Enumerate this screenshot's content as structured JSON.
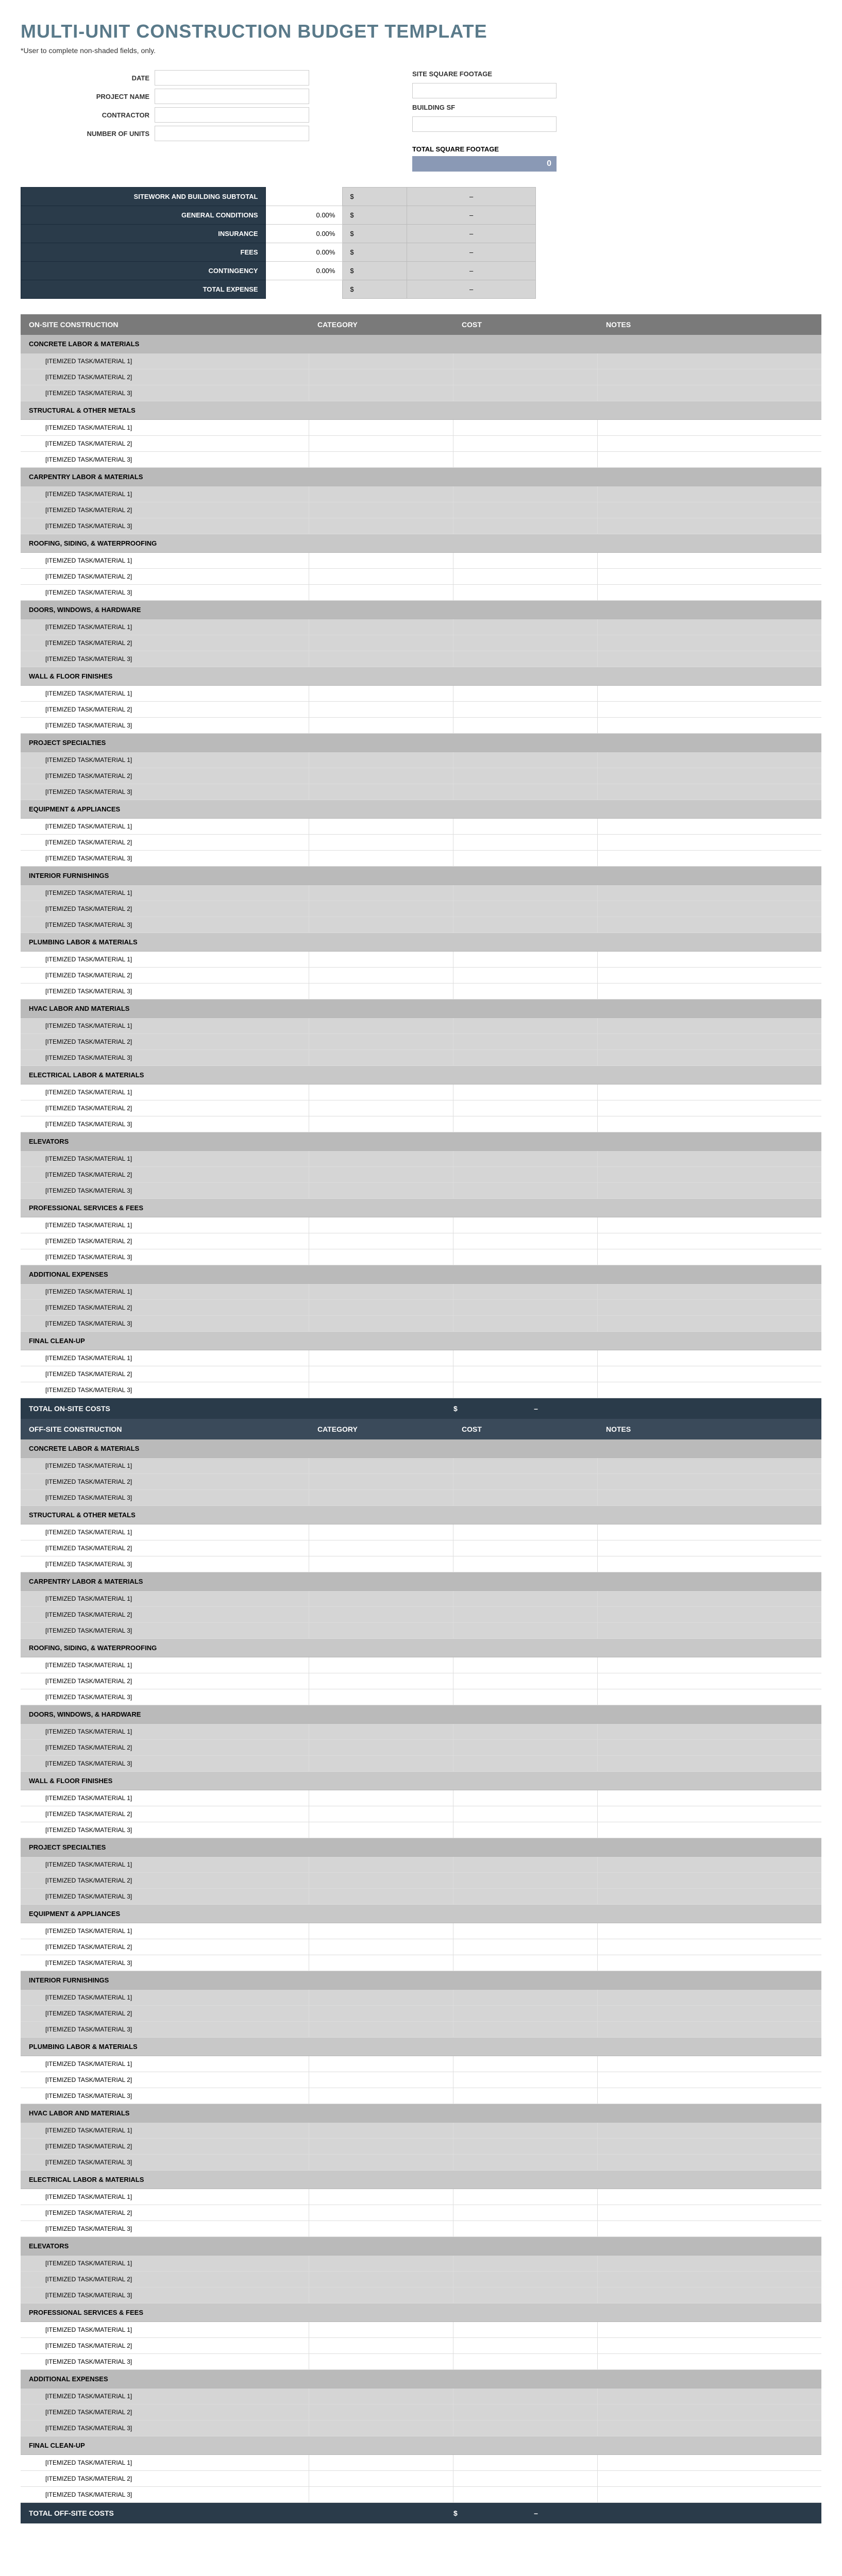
{
  "title": "MULTI-UNIT CONSTRUCTION BUDGET TEMPLATE",
  "subtitle": "*User to complete non-shaded fields, only.",
  "leftFields": [
    {
      "label": "DATE"
    },
    {
      "label": "PROJECT NAME"
    },
    {
      "label": "CONTRACTOR"
    },
    {
      "label": "NUMBER OF UNITS"
    }
  ],
  "rightFields": [
    {
      "label": "SITE SQUARE FOOTAGE"
    },
    {
      "label": "BUILDING SF"
    }
  ],
  "totalSfLabel": "TOTAL SQUARE FOOTAGE",
  "totalSfValue": "0",
  "summary": [
    {
      "label": "SITEWORK AND BUILDING SUBTOTAL",
      "pct": "",
      "dollar": "$",
      "val": "–"
    },
    {
      "label": "GENERAL CONDITIONS",
      "pct": "0.00%",
      "dollar": "$",
      "val": "–"
    },
    {
      "label": "INSURANCE",
      "pct": "0.00%",
      "dollar": "$",
      "val": "–"
    },
    {
      "label": "FEES",
      "pct": "0.00%",
      "dollar": "$",
      "val": "–"
    },
    {
      "label": "CONTINGENCY",
      "pct": "0.00%",
      "dollar": "$",
      "val": "–"
    },
    {
      "label": "TOTAL EXPENSE",
      "pct": "",
      "dollar": "$",
      "val": "–"
    }
  ],
  "headers": {
    "name_onsite": "ON-SITE CONSTRUCTION",
    "name_offsite": "OFF-SITE CONSTRUCTION",
    "category": "CATEGORY",
    "cost": "COST",
    "notes": "NOTES"
  },
  "categories": [
    "CONCRETE LABOR & MATERIALS",
    "STRUCTURAL & OTHER METALS",
    "CARPENTRY LABOR & MATERIALS",
    "ROOFING, SIDING, & WATERPROOFING",
    "DOORS, WINDOWS, & HARDWARE",
    "WALL & FLOOR FINISHES",
    "PROJECT SPECIALTIES",
    "EQUIPMENT & APPLIANCES",
    "INTERIOR FURNISHINGS",
    "PLUMBING LABOR & MATERIALS",
    "HVAC LABOR AND MATERIALS",
    "ELECTRICAL LABOR & MATERIALS",
    "ELEVATORS",
    "PROFESSIONAL SERVICES & FEES",
    "ADDITIONAL EXPENSES",
    "FINAL CLEAN-UP"
  ],
  "itemPlaceholder": "[ITEMIZED TASK/MATERIAL {n}]",
  "totals": {
    "onsite_label": "TOTAL ON-SITE COSTS",
    "offsite_label": "TOTAL OFF-SITE COSTS",
    "dollar": "$",
    "val": "–"
  }
}
